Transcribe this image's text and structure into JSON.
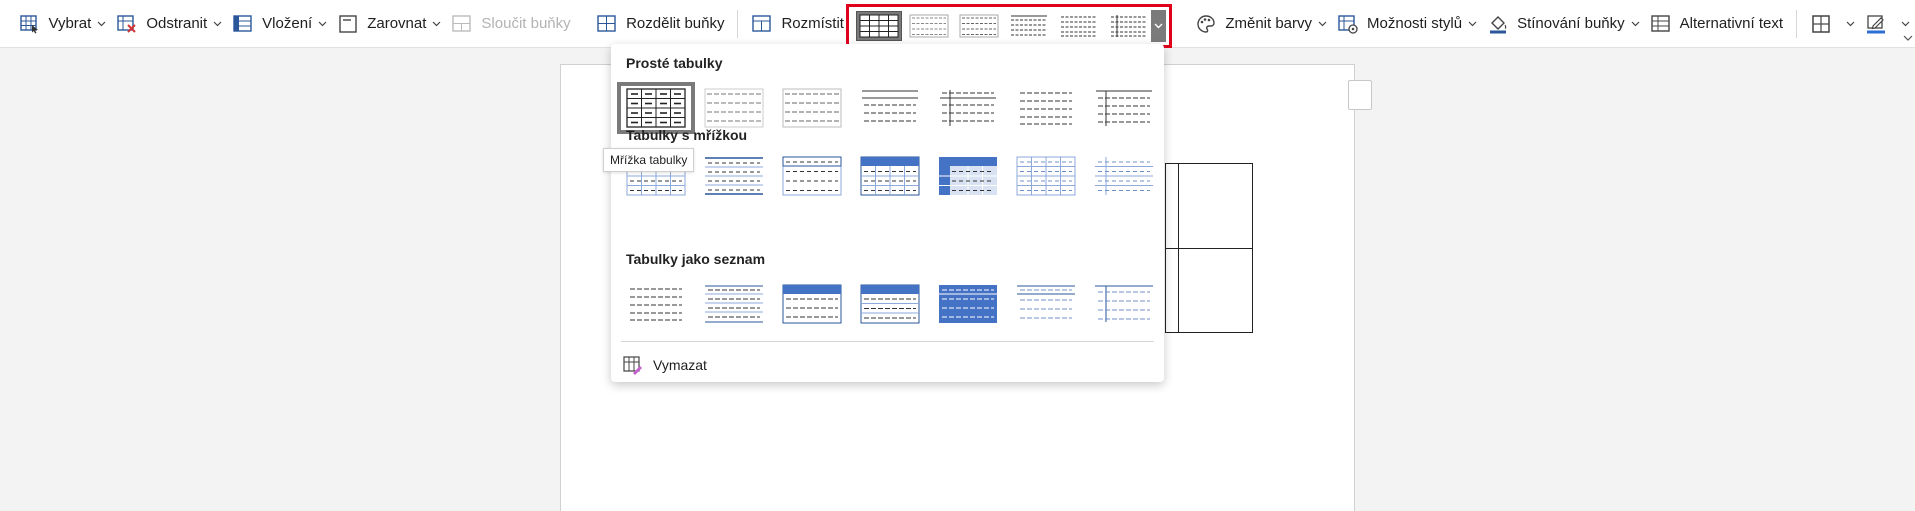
{
  "ribbon": {
    "items": [
      {
        "label": "Vybrat",
        "icon": "select-table-icon",
        "enabled": true
      },
      {
        "label": "Odstranit",
        "icon": "delete-table-icon",
        "enabled": true
      },
      {
        "label": "Vložení",
        "icon": "insert-rows-icon",
        "enabled": true
      },
      {
        "label": "Zarovnat",
        "icon": "align-icon",
        "enabled": true
      },
      {
        "label": "Sloučit buňky",
        "icon": "merge-cells-icon",
        "enabled": false
      },
      {
        "label": "Rozdělit buňky",
        "icon": "split-cells-icon",
        "enabled": true
      },
      {
        "label": "Rozmístit",
        "icon": "distribute-icon",
        "enabled": true
      },
      {
        "label": "Změnit barvy",
        "icon": "palette-icon",
        "enabled": true
      },
      {
        "label": "Možnosti stylů",
        "icon": "style-options-icon",
        "enabled": true
      },
      {
        "label": "Stínování buňky",
        "icon": "paint-bucket-icon",
        "enabled": true
      },
      {
        "label": "Alternativní text",
        "icon": "alt-text-icon",
        "enabled": true
      }
    ],
    "accent": "#2b579a",
    "highlight": "#e0001b"
  },
  "styles_menu": {
    "sections": [
      {
        "title": "Prosté tabulky"
      },
      {
        "title": "Tabulky s mřížkou"
      },
      {
        "title": "Tabulky jako seznam"
      }
    ],
    "clear_label": "Vymazat",
    "tooltip": "Mřížka tabulky"
  }
}
